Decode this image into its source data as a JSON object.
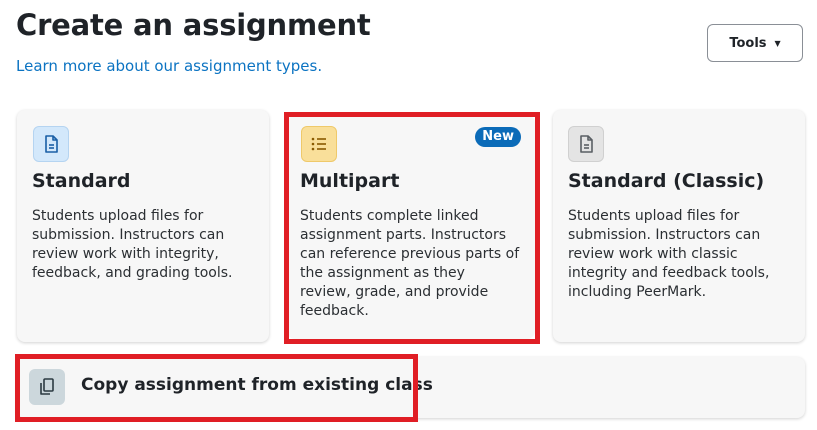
{
  "page": {
    "title": "Create an assignment",
    "learn_more_link": "Learn more about our assignment types.",
    "tools_button": "Tools"
  },
  "cards": [
    {
      "heading": "Standard",
      "description": "Students upload files for submission. Instructors can review work with integrity, feedback, and grading tools.",
      "icon": "document-icon"
    },
    {
      "heading": "Multipart",
      "badge": "New",
      "description": "Students complete linked assignment parts. Instructors can reference previous parts of the assignment as they review, grade, and provide feedback.",
      "icon": "list-icon"
    },
    {
      "heading": "Standard (Classic)",
      "description": "Students upload files for submission. Instructors can review work with classic integrity and feedback tools, including PeerMark.",
      "icon": "document-icon"
    }
  ],
  "copy_assignment": {
    "label": "Copy assignment from existing class",
    "icon": "copy-icon"
  },
  "colors": {
    "link": "#0b73c2",
    "badge": "#0b6bb8",
    "highlight": "#e01e25",
    "standard_icon_bg": "#d3e8fb",
    "multipart_icon_bg": "#f9df9a",
    "classic_icon_bg": "#e4e4e4",
    "copy_icon_bg": "#ccd7dc"
  }
}
